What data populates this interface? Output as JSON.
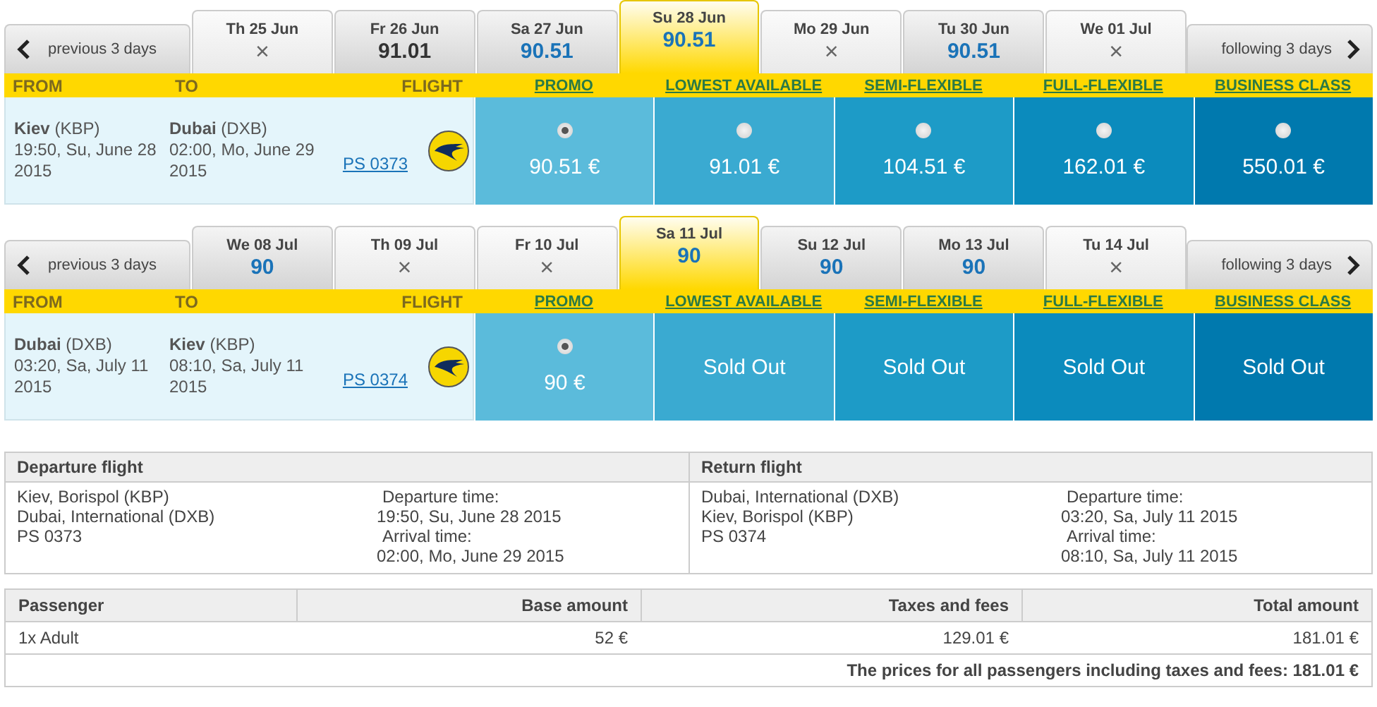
{
  "journeys": [
    {
      "prev_label": "previous 3 days",
      "next_label": "following 3 days",
      "days": [
        {
          "date": "Th 25 Jun",
          "kind": "none",
          "value": "×",
          "selected": false
        },
        {
          "date": "Fr 26 Jun",
          "kind": "price",
          "value": "91.01",
          "highlighted": false,
          "selected": false
        },
        {
          "date": "Sa 27 Jun",
          "kind": "price",
          "value": "90.51",
          "highlighted": true,
          "selected": false
        },
        {
          "date": "Su 28 Jun",
          "kind": "price",
          "value": "90.51",
          "highlighted": true,
          "selected": true
        },
        {
          "date": "Mo 29 Jun",
          "kind": "none",
          "value": "×",
          "selected": false
        },
        {
          "date": "Tu 30 Jun",
          "kind": "price",
          "value": "90.51",
          "highlighted": true,
          "selected": false
        },
        {
          "date": "We 01 Jul",
          "kind": "none",
          "value": "×",
          "selected": false
        }
      ],
      "columns": {
        "from": "FROM",
        "to": "TO",
        "flight": "FLIGHT"
      },
      "fare_classes": [
        {
          "label": "PROMO",
          "color": "#5bbbdb"
        },
        {
          "label": "LOWEST AVAILABLE",
          "color": "#3aaad1"
        },
        {
          "label": "SEMI-FLEXIBLE",
          "color": "#1d9bc7"
        },
        {
          "label": "FULL-FLEXIBLE",
          "color": "#0b8bbd"
        },
        {
          "label": "BUSINESS CLASS",
          "color": "#0079ae"
        }
      ],
      "flight": {
        "from": "**Kiev** (KBP)",
        "from_time": "19:50, Su, June 28 2015",
        "to": "**Dubai** (DXB)",
        "to_time": "02:00, Mo, June 29 2015",
        "number": "PS 0373"
      },
      "fares": [
        {
          "kind": "price",
          "text": "90.51 €",
          "selected": true
        },
        {
          "kind": "price",
          "text": "91.01 €",
          "selected": false
        },
        {
          "kind": "price",
          "text": "104.51 €",
          "selected": false
        },
        {
          "kind": "price",
          "text": "162.01 €",
          "selected": false
        },
        {
          "kind": "price",
          "text": "550.01 €",
          "selected": false
        }
      ]
    },
    {
      "prev_label": "previous 3 days",
      "next_label": "following 3 days",
      "days": [
        {
          "date": "We 08 Jul",
          "kind": "price",
          "value": "90",
          "highlighted": true,
          "selected": false
        },
        {
          "date": "Th 09 Jul",
          "kind": "none",
          "value": "×",
          "selected": false
        },
        {
          "date": "Fr 10 Jul",
          "kind": "none",
          "value": "×",
          "selected": false
        },
        {
          "date": "Sa 11 Jul",
          "kind": "price",
          "value": "90",
          "highlighted": true,
          "selected": true
        },
        {
          "date": "Su 12 Jul",
          "kind": "price",
          "value": "90",
          "highlighted": true,
          "selected": false
        },
        {
          "date": "Mo 13 Jul",
          "kind": "price",
          "value": "90",
          "highlighted": true,
          "selected": false
        },
        {
          "date": "Tu 14 Jul",
          "kind": "none",
          "value": "×",
          "selected": false
        }
      ],
      "columns": {
        "from": "FROM",
        "to": "TO",
        "flight": "FLIGHT"
      },
      "fare_classes": [
        {
          "label": "PROMO",
          "color": "#5bbbdb"
        },
        {
          "label": "LOWEST AVAILABLE",
          "color": "#3aaad1"
        },
        {
          "label": "SEMI-FLEXIBLE",
          "color": "#1d9bc7"
        },
        {
          "label": "FULL-FLEXIBLE",
          "color": "#0b8bbd"
        },
        {
          "label": "BUSINESS CLASS",
          "color": "#0079ae"
        }
      ],
      "flight": {
        "from": "**Dubai** (DXB)",
        "from_time": "03:20, Sa, July 11 2015",
        "to": "**Kiev** (KBP)",
        "to_time": "08:10, Sa, July 11 2015",
        "number": "PS 0374"
      },
      "fares": [
        {
          "kind": "price",
          "text": "90 €",
          "selected": true
        },
        {
          "kind": "sold_out",
          "text": "Sold Out"
        },
        {
          "kind": "sold_out",
          "text": "Sold Out"
        },
        {
          "kind": "sold_out",
          "text": "Sold Out"
        },
        {
          "kind": "sold_out",
          "text": "Sold Out"
        }
      ]
    }
  ],
  "summary": {
    "sections": [
      {
        "title": "Departure flight",
        "route": [
          "Kiev, Borispol (KBP)",
          "Dubai, International (DXB)",
          "PS 0373"
        ],
        "times": [
          {
            "kind": "label",
            "text": "Departure time:"
          },
          {
            "kind": "value",
            "text": "19:50, Su, June 28 2015"
          },
          {
            "kind": "label",
            "text": "Arrival time:"
          },
          {
            "kind": "value",
            "text": "02:00, Mo, June 29 2015"
          }
        ]
      },
      {
        "title": "Return flight",
        "route": [
          "Dubai, International (DXB)",
          "Kiev, Borispol (KBP)",
          "PS 0374"
        ],
        "times": [
          {
            "kind": "label",
            "text": "Departure time:"
          },
          {
            "kind": "value",
            "text": "03:20, Sa, July 11 2015"
          },
          {
            "kind": "label",
            "text": "Arrival time:"
          },
          {
            "kind": "value",
            "text": "08:10, Sa, July 11 2015"
          }
        ]
      }
    ]
  },
  "prices": {
    "columns": [
      "Passenger",
      "Base amount",
      "Taxes and fees",
      "Total amount"
    ],
    "rows": [
      [
        "1x Adult",
        "52 €",
        "129.01 €",
        "181.01 €"
      ]
    ],
    "total": "The prices for all passengers including taxes and fees: 181.01 €"
  }
}
